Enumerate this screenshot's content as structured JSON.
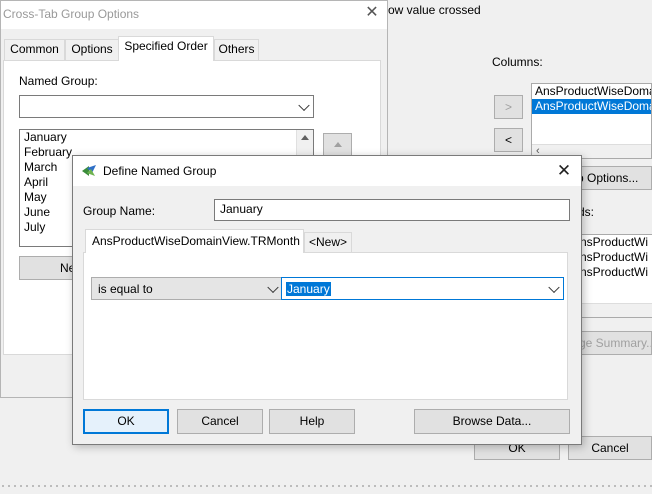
{
  "background_window": {
    "header_text": "row value crossed",
    "columns_label": "Columns:",
    "columns_items": [
      "AnsProductWiseDoma",
      "AnsProductWiseDoma"
    ],
    "add_arrow": ">",
    "remove_arrow": "<",
    "group_options_button": "p Options...",
    "fields_label": "ds:",
    "fields_items": [
      "nsProductWi",
      "nsProductWi",
      "nsProductWi"
    ],
    "summary_button": "ge Summary...",
    "ok_button": "OK",
    "cancel_button": "Cancel"
  },
  "crosstab_dialog": {
    "title": "Cross-Tab Group Options",
    "tabs": [
      "Common",
      "Options",
      "Specified Order",
      "Others"
    ],
    "named_group_label": "Named Group:",
    "named_group_value": "",
    "months": [
      "January",
      "February",
      "March",
      "April",
      "May",
      "June",
      "July"
    ],
    "new_button": "Ne"
  },
  "define_dialog": {
    "title": "Define Named Group",
    "group_name_label": "Group Name:",
    "group_name_value": "January",
    "tabs": [
      "AnsProductWiseDomainView.TRMonth",
      "<New>"
    ],
    "operator_value": "is equal to",
    "value_value": "January",
    "ok_button": "OK",
    "cancel_button": "Cancel",
    "help_button": "Help",
    "browse_button": "Browse Data..."
  },
  "colors": {
    "selection": "#0078d7",
    "dialog_bg": "#f0f0f0",
    "button_bg": "#e1e1e1"
  }
}
